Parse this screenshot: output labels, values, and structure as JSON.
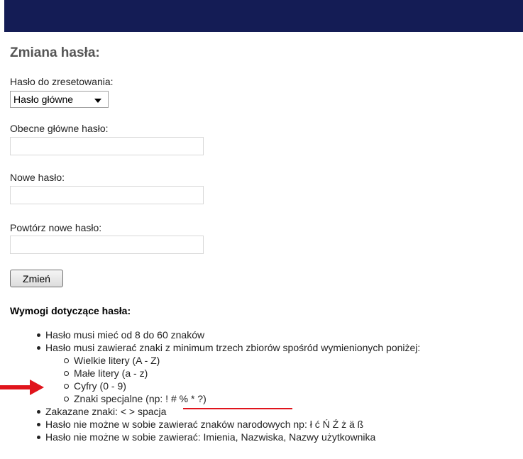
{
  "colors": {
    "header": "#141c55",
    "annotation": "#e0141c"
  },
  "form": {
    "title": "Zmiana hasła:",
    "reset_label": "Hasło do zresetowania:",
    "reset_selected": "Hasło główne",
    "current_label": "Obecne główne hasło:",
    "new_label": "Nowe hasło:",
    "repeat_label": "Powtórz nowe hasło:",
    "submit_label": "Zmień"
  },
  "requirements": {
    "title": "Wymogi dotyczące hasła:",
    "items": [
      "Hasło musi mieć od 8 do 60 znaków",
      "Hasło musi zawierać znaki z minimum trzech zbiorów spośród wymienionych poniżej:",
      "Zakazane znaki: < > spacja",
      "Hasło nie możne w sobie zawierać znaków narodowych np: ł ć Ń Ź ż ä ß",
      "Hasło nie możne w sobie zawierać: Imienia, Nazwiska, Nazwy użytkownika"
    ],
    "sub_items": [
      "Wielkie litery (A - Z)",
      "Małe litery (a - z)",
      "Cyfry (0 - 9)",
      "Znaki specjalne (np: ! # % * ?)"
    ]
  },
  "annotations": {
    "arrow_icon": "arrow-right-icon"
  }
}
